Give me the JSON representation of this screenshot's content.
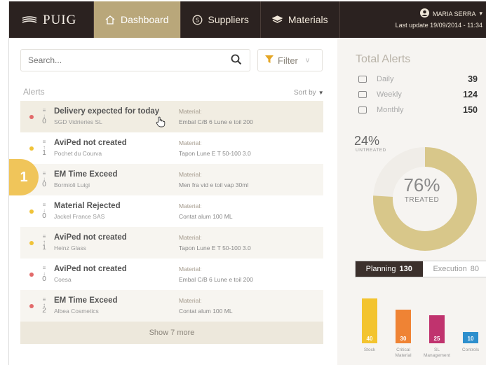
{
  "brand": "PUIG",
  "nav": [
    {
      "label": "Dashboard",
      "icon": "home-icon",
      "active": true
    },
    {
      "label": "Suppliers",
      "icon": "supplier-icon",
      "active": false
    },
    {
      "label": "Materials",
      "icon": "materials-icon",
      "active": false
    }
  ],
  "user": {
    "name": "MARIA SERRA",
    "last_update": "Last update 19/09/2014 - 11:34"
  },
  "search": {
    "placeholder": "Search..."
  },
  "filter": {
    "label": "Filter"
  },
  "alerts_label": "Alerts",
  "sort_label": "Sort by",
  "alerts": [
    {
      "title": "Delivery expected for today",
      "supplier": "SGD Vidrieries SL",
      "material_label": "Material:",
      "material": "Embal C/B 6 Lune e toil 200",
      "priority": "0",
      "dot": "#e26a6a"
    },
    {
      "title": "AviPed not created",
      "supplier": "Pochet du Courva",
      "material_label": "Material:",
      "material": "Tapon Lune E T 50-100 3.0",
      "priority": "1",
      "dot": "#f0c338"
    },
    {
      "title": "EM Time Exceed",
      "supplier": "Bormioli Luigi",
      "material_label": "Material:",
      "material": "Men fra vid e toil vap 30ml",
      "priority": "0",
      "dot": "#e26a6a"
    },
    {
      "title": "Material Rejected",
      "supplier": "Jackel France SAS",
      "material_label": "Material:",
      "material": "Contat alum 100 ML",
      "priority": "0",
      "dot": "#f0c338"
    },
    {
      "title": "AviPed not created",
      "supplier": "Heinz Glass",
      "material_label": "Material:",
      "material": "Tapon Lune E T 50-100 3.0",
      "priority": "1",
      "dot": "#f0c338"
    },
    {
      "title": "AviPed not created",
      "supplier": "Coesa",
      "material_label": "Material:",
      "material": "Embal C/B 6 Lune e toil 200",
      "priority": "0",
      "dot": "#e26a6a"
    },
    {
      "title": "EM Time Exceed",
      "supplier": "Albea Cosmetics",
      "material_label": "Material:",
      "material": "Contat alum 100 ML",
      "priority": "2",
      "dot": "#e26a6a"
    }
  ],
  "show_more": "Show 7 more",
  "badge": "1",
  "total_alerts": {
    "title": "Total Alerts",
    "rows": [
      {
        "label": "Daily",
        "value": "39"
      },
      {
        "label": "Weekly",
        "value": "124"
      },
      {
        "label": "Monthly",
        "value": "150"
      }
    ]
  },
  "donut": {
    "untreated_pct": "24%",
    "untreated_label": "UNTREATED",
    "treated_pct": "76%",
    "treated_label": "TREATED",
    "treated_value": 76,
    "treated_color": "#d8c78a",
    "untreated_color": "#f0ede8"
  },
  "tabs": [
    {
      "label": "Planning",
      "count": "130",
      "active": true
    },
    {
      "label": "Execution",
      "count": "80",
      "active": false
    }
  ],
  "chart_data": {
    "type": "bar",
    "categories": [
      "Stock",
      "Critical Material",
      "SL Management",
      "Controls"
    ],
    "values": [
      40,
      30,
      25,
      10
    ],
    "ylim": [
      0,
      45
    ],
    "colors": [
      "#f3c42f",
      "#ef8334",
      "#c0336e",
      "#2d8fcd"
    ]
  }
}
